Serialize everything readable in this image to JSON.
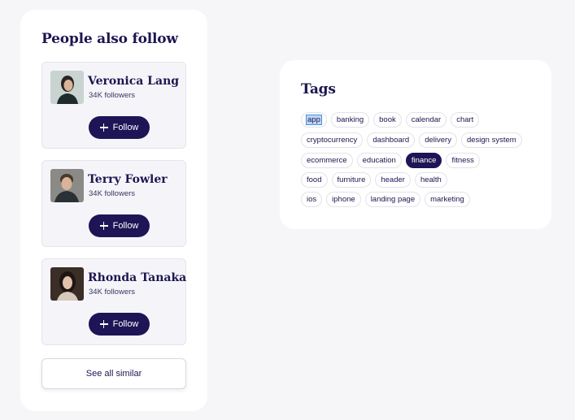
{
  "people_card": {
    "title": "People also follow",
    "people": [
      {
        "name": "Veronica Lang",
        "followers": "34K followers",
        "follow_label": "Follow"
      },
      {
        "name": "Terry Fowler",
        "followers": "34K followers",
        "follow_label": "Follow"
      },
      {
        "name": "Rhonda Tanaka",
        "followers": "34K followers",
        "follow_label": "Follow"
      }
    ],
    "see_all_label": "See all similar"
  },
  "tags_card": {
    "title": "Tags",
    "rows": [
      [
        "app",
        "banking",
        "book",
        "calendar",
        "chart"
      ],
      [
        "cryptocurrency",
        "dashboard",
        "delivery",
        "design system"
      ],
      [
        "ecommerce",
        "education",
        "finance",
        "fitness"
      ],
      [
        "food",
        "furniture",
        "header",
        "health"
      ],
      [
        "ios",
        "iphone",
        "landing page",
        "marketing"
      ]
    ],
    "active_tag": "finance",
    "selected_tag": "app"
  },
  "colors": {
    "accent": "#1e1556",
    "background": "#f6f6f8",
    "card": "#ffffff"
  },
  "icons": {
    "follow": "plus-icon"
  }
}
